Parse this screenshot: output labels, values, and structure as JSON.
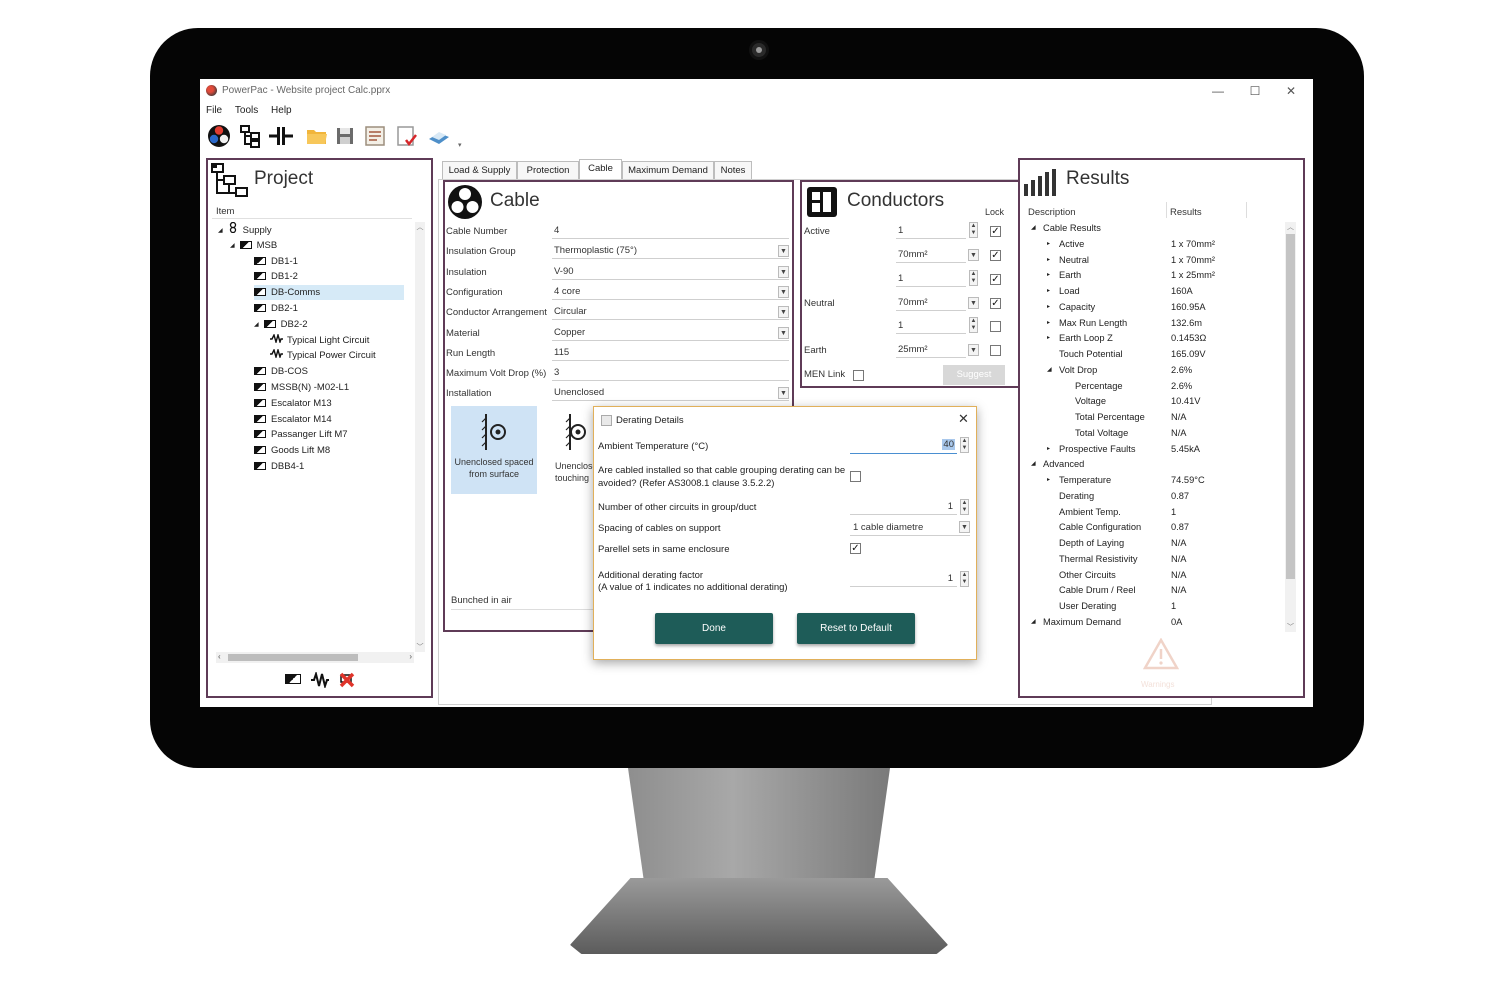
{
  "window": {
    "title": "PowerPac - Website project Calc.pprx",
    "minimize": "—",
    "maximize": "☐",
    "close": "✕"
  },
  "menu": [
    "File",
    "Tools",
    "Help"
  ],
  "project": {
    "title": "Project",
    "column": "Item",
    "tree": [
      {
        "label": "Supply",
        "level": 0,
        "expander": "◢",
        "icon": "supply-icon"
      },
      {
        "label": "MSB",
        "level": 1,
        "expander": "◢",
        "icon": "board-icon"
      },
      {
        "label": "DB1-1",
        "level": 2,
        "expander": "",
        "icon": "board-icon"
      },
      {
        "label": "DB1-2",
        "level": 2,
        "expander": "",
        "icon": "board-icon"
      },
      {
        "label": "DB-Comms",
        "level": 2,
        "expander": "",
        "icon": "board-icon",
        "selected": true
      },
      {
        "label": "DB2-1",
        "level": 2,
        "expander": "",
        "icon": "board-icon"
      },
      {
        "label": "DB2-2",
        "level": 2,
        "expander": "◢",
        "icon": "board-icon"
      },
      {
        "label": "Typical Light Circuit",
        "level": 3,
        "expander": "",
        "icon": "circuit-icon"
      },
      {
        "label": "Typical Power Circuit",
        "level": 3,
        "expander": "",
        "icon": "circuit-icon"
      },
      {
        "label": "DB-COS",
        "level": 2,
        "expander": "",
        "icon": "board-icon"
      },
      {
        "label": "MSSB(N) -M02-L1",
        "level": 2,
        "expander": "",
        "icon": "board-icon"
      },
      {
        "label": "Escalator M13",
        "level": 2,
        "expander": "",
        "icon": "board-icon"
      },
      {
        "label": "Escalator M14",
        "level": 2,
        "expander": "",
        "icon": "board-icon"
      },
      {
        "label": "Passanger Lift M7",
        "level": 2,
        "expander": "",
        "icon": "board-icon"
      },
      {
        "label": "Goods Lift M8",
        "level": 2,
        "expander": "",
        "icon": "board-icon"
      },
      {
        "label": "DBB4-1",
        "level": 2,
        "expander": "",
        "icon": "board-icon"
      }
    ]
  },
  "tabs": [
    "Load & Supply",
    "Protection",
    "Cable",
    "Maximum Demand",
    "Notes"
  ],
  "active_tab": "Cable",
  "cable": {
    "title": "Cable",
    "fields": [
      {
        "label": "Cable Number",
        "value": "4",
        "dropdown": false
      },
      {
        "label": "Insulation Group",
        "value": "Thermoplastic (75°)",
        "dropdown": true
      },
      {
        "label": "Insulation",
        "value": "V-90",
        "dropdown": true
      },
      {
        "label": "Configuration",
        "value": "4 core",
        "dropdown": true
      },
      {
        "label": "Conductor Arrangement",
        "value": "Circular",
        "dropdown": true
      },
      {
        "label": "Material",
        "value": "Copper",
        "dropdown": true
      },
      {
        "label": "Run Length",
        "value": "115",
        "dropdown": false
      },
      {
        "label": "Maximum Volt Drop (%)",
        "value": "3",
        "dropdown": false
      },
      {
        "label": "Installation",
        "value": "Unenclosed",
        "dropdown": true
      }
    ],
    "install_options": [
      {
        "label": "Unenclosed spaced from surface",
        "selected": true
      },
      {
        "label": "Unenclosed touching",
        "selected": false
      }
    ],
    "bunched": "Bunched in air"
  },
  "conductors": {
    "title": "Conductors",
    "lock_label": "Lock",
    "rows": [
      {
        "label": "Active",
        "count": "1",
        "size": "70mm²",
        "lock_count": true,
        "lock_size": true
      },
      {
        "label": "Neutral",
        "count": "1",
        "size": "70mm²",
        "lock_count": true,
        "lock_size": true
      },
      {
        "label": "Earth",
        "count": "1",
        "size": "25mm²",
        "lock_count": false,
        "lock_size": false
      }
    ],
    "men_link": "MEN Link",
    "suggest": "Suggest"
  },
  "results": {
    "title": "Results",
    "col_desc": "Description",
    "col_res": "Results",
    "rows": [
      {
        "label": "Cable Results",
        "value": "",
        "level": 0,
        "exp": "◢"
      },
      {
        "label": "Active",
        "value": "1 x 70mm²",
        "level": 1,
        "exp": "▸"
      },
      {
        "label": "Neutral",
        "value": "1 x 70mm²",
        "level": 1,
        "exp": "▸"
      },
      {
        "label": "Earth",
        "value": "1 x 25mm²",
        "level": 1,
        "exp": "▸"
      },
      {
        "label": "Load",
        "value": "160A",
        "level": 1,
        "exp": "▸"
      },
      {
        "label": "Capacity",
        "value": "160.95A",
        "level": 1,
        "exp": "▸"
      },
      {
        "label": "Max Run Length",
        "value": "132.6m",
        "level": 1,
        "exp": "▸"
      },
      {
        "label": "Earth Loop Z",
        "value": "0.1453Ω",
        "level": 1,
        "exp": "▸"
      },
      {
        "label": "Touch Potential",
        "value": "165.09V",
        "level": 1,
        "exp": ""
      },
      {
        "label": "Volt Drop",
        "value": "2.6%",
        "level": 1,
        "exp": "◢"
      },
      {
        "label": "Percentage",
        "value": "2.6%",
        "level": 2,
        "exp": ""
      },
      {
        "label": "Voltage",
        "value": "10.41V",
        "level": 2,
        "exp": ""
      },
      {
        "label": "Total Percentage",
        "value": "N/A",
        "level": 2,
        "exp": ""
      },
      {
        "label": "Total Voltage",
        "value": "N/A",
        "level": 2,
        "exp": ""
      },
      {
        "label": "Prospective Faults",
        "value": "5.45kA",
        "level": 1,
        "exp": "▸"
      },
      {
        "label": "Advanced",
        "value": "",
        "level": 0,
        "exp": "◢"
      },
      {
        "label": "Temperature",
        "value": "74.59°C",
        "level": 1,
        "exp": "▸"
      },
      {
        "label": "Derating",
        "value": "0.87",
        "level": 1,
        "exp": ""
      },
      {
        "label": "Ambient Temp.",
        "value": "1",
        "level": 1,
        "exp": ""
      },
      {
        "label": "Cable Configuration",
        "value": "0.87",
        "level": 1,
        "exp": ""
      },
      {
        "label": "Depth of Laying",
        "value": "N/A",
        "level": 1,
        "exp": ""
      },
      {
        "label": "Thermal Resistivity",
        "value": "N/A",
        "level": 1,
        "exp": ""
      },
      {
        "label": "Other Circuits",
        "value": "N/A",
        "level": 1,
        "exp": ""
      },
      {
        "label": "Cable Drum / Reel",
        "value": "N/A",
        "level": 1,
        "exp": ""
      },
      {
        "label": "User Derating",
        "value": "1",
        "level": 1,
        "exp": ""
      },
      {
        "label": "Maximum Demand",
        "value": "0A",
        "level": 0,
        "exp": "◢"
      }
    ],
    "warning": "Warnings"
  },
  "dialog": {
    "title": "Derating Details",
    "ambient_label": "Ambient Temperature (°C)",
    "ambient_value": "40",
    "grouping_label_1": "Are cabled installed so that cable grouping derating can be",
    "grouping_label_2": "avoided? (Refer AS3008.1 clause 3.5.2.2)",
    "circuits_label": "Number of other circuits in group/duct",
    "circuits_value": "1",
    "spacing_label": "Spacing of cables on support",
    "spacing_value": "1 cable diametre",
    "parallel_label": "Parellel sets in same enclosure",
    "additional_label_1": "Additional derating factor",
    "additional_label_2": "(A value of 1 indicates no additional derating)",
    "additional_value": "1",
    "done": "Done",
    "reset": "Reset to Default"
  },
  "colors": {
    "panel_border": "#5f3b57",
    "button_teal": "#1e5c58",
    "selection": "#d6eaf7"
  }
}
